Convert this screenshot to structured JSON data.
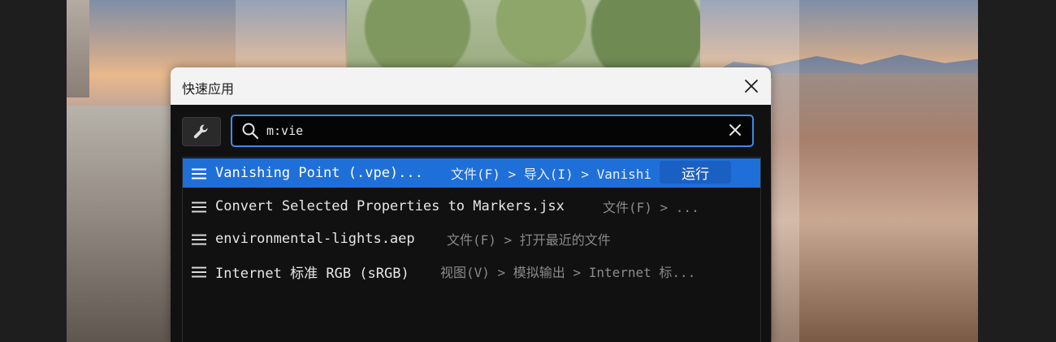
{
  "window": {
    "title": "快速应用",
    "close_icon": "close-icon"
  },
  "toolbar": {
    "settings_icon": "wrench-icon"
  },
  "search": {
    "value": "m:vie",
    "search_icon": "search-icon",
    "clear_icon": "clear-icon"
  },
  "results": [
    {
      "name": "Vanishing Point (.vpe)...",
      "path": "文件(F) > 导入(I) > Vanishi",
      "selected": true,
      "action_label": "运行"
    },
    {
      "name": "Convert Selected Properties to Markers.jsx",
      "path": "文件(F) > ...",
      "selected": false
    },
    {
      "name": "environmental-lights.aep",
      "path": "文件(F) > 打开最近的文件",
      "selected": false
    },
    {
      "name": "Internet 标准 RGB (sRGB)",
      "path": "视图(V) > 模拟输出 > Internet 标...",
      "selected": false
    }
  ],
  "colors": {
    "accent": "#3e8be8",
    "selected_row": "#1f6fd8",
    "run_button": "#1a5fc2"
  }
}
